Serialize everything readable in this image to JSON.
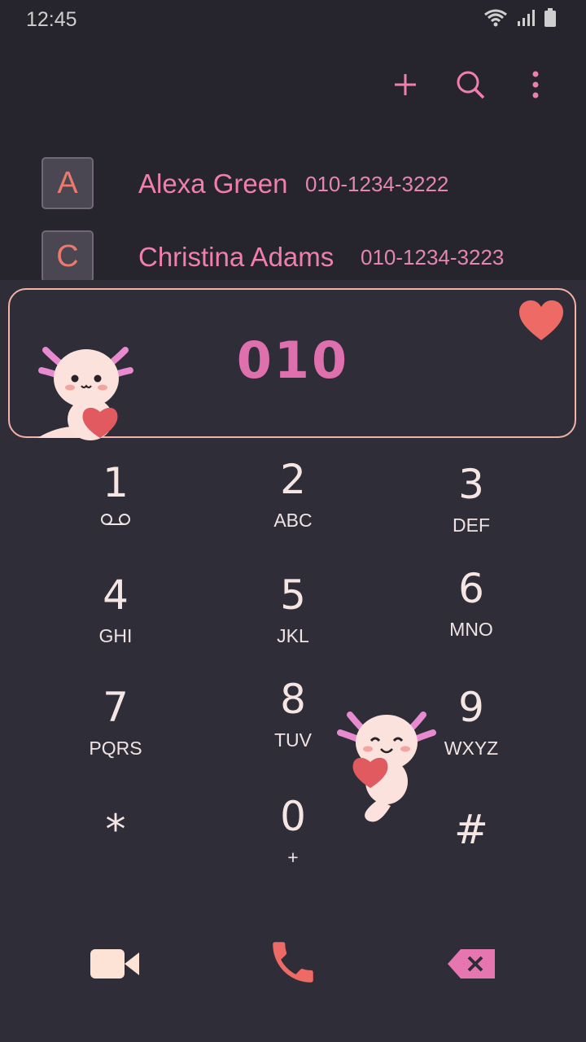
{
  "status_bar": {
    "time": "12:45",
    "icons": [
      "wifi-icon",
      "signal-icon",
      "battery-icon"
    ]
  },
  "toolbar": {
    "icons": [
      "add-icon",
      "search-icon",
      "more-vert-icon"
    ]
  },
  "contacts": [
    {
      "initial": "A",
      "name": "Alexa Green",
      "number": "010-1234-3222"
    },
    {
      "initial": "C",
      "name": "Christina Adams",
      "number": "010-1234-3223"
    }
  ],
  "dialer": {
    "entered_number": "010"
  },
  "keys": [
    {
      "digit": "1",
      "letters": "",
      "icon": "voicemail-icon"
    },
    {
      "digit": "2",
      "letters": "ABC"
    },
    {
      "digit": "3",
      "letters": "DEF"
    },
    {
      "digit": "4",
      "letters": "GHI"
    },
    {
      "digit": "5",
      "letters": "JKL"
    },
    {
      "digit": "6",
      "letters": "MNO"
    },
    {
      "digit": "7",
      "letters": "PQRS"
    },
    {
      "digit": "8",
      "letters": "TUV"
    },
    {
      "digit": "9",
      "letters": "WXYZ"
    },
    {
      "digit": "*",
      "letters": ""
    },
    {
      "digit": "0",
      "letters": "+"
    },
    {
      "digit": "#",
      "letters": ""
    }
  ],
  "actions": [
    "video-call-icon",
    "phone-call-icon",
    "backspace-icon"
  ],
  "colors": {
    "accent_pink": "#ee7fb0",
    "call_coral": "#ee6a64",
    "display_border": "#f2b2a8"
  }
}
